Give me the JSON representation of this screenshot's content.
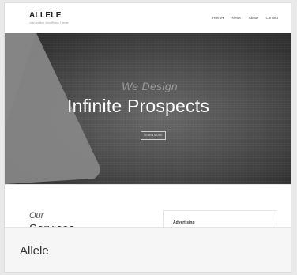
{
  "theme": {
    "logo": "ALLELE",
    "tagline": "Just Another WordPress Theme",
    "nav": [
      "Home",
      "News",
      "About",
      "Contact"
    ],
    "nav_home_caret": "▾",
    "hero": {
      "subtitle": "We Design",
      "title": "Infinite Prospects",
      "button": "LEARN MORE"
    },
    "content": {
      "section_heading_italic": "Our",
      "section_heading_next": "Services",
      "widget_title": "Advertising"
    }
  },
  "caption": {
    "theme_name": "Allele"
  },
  "colors": {
    "background": "#e9e9e9",
    "hero_dark": "#333333",
    "hero_triangle": "#8c8c8c",
    "caption_bg": "#f6f6f6"
  }
}
